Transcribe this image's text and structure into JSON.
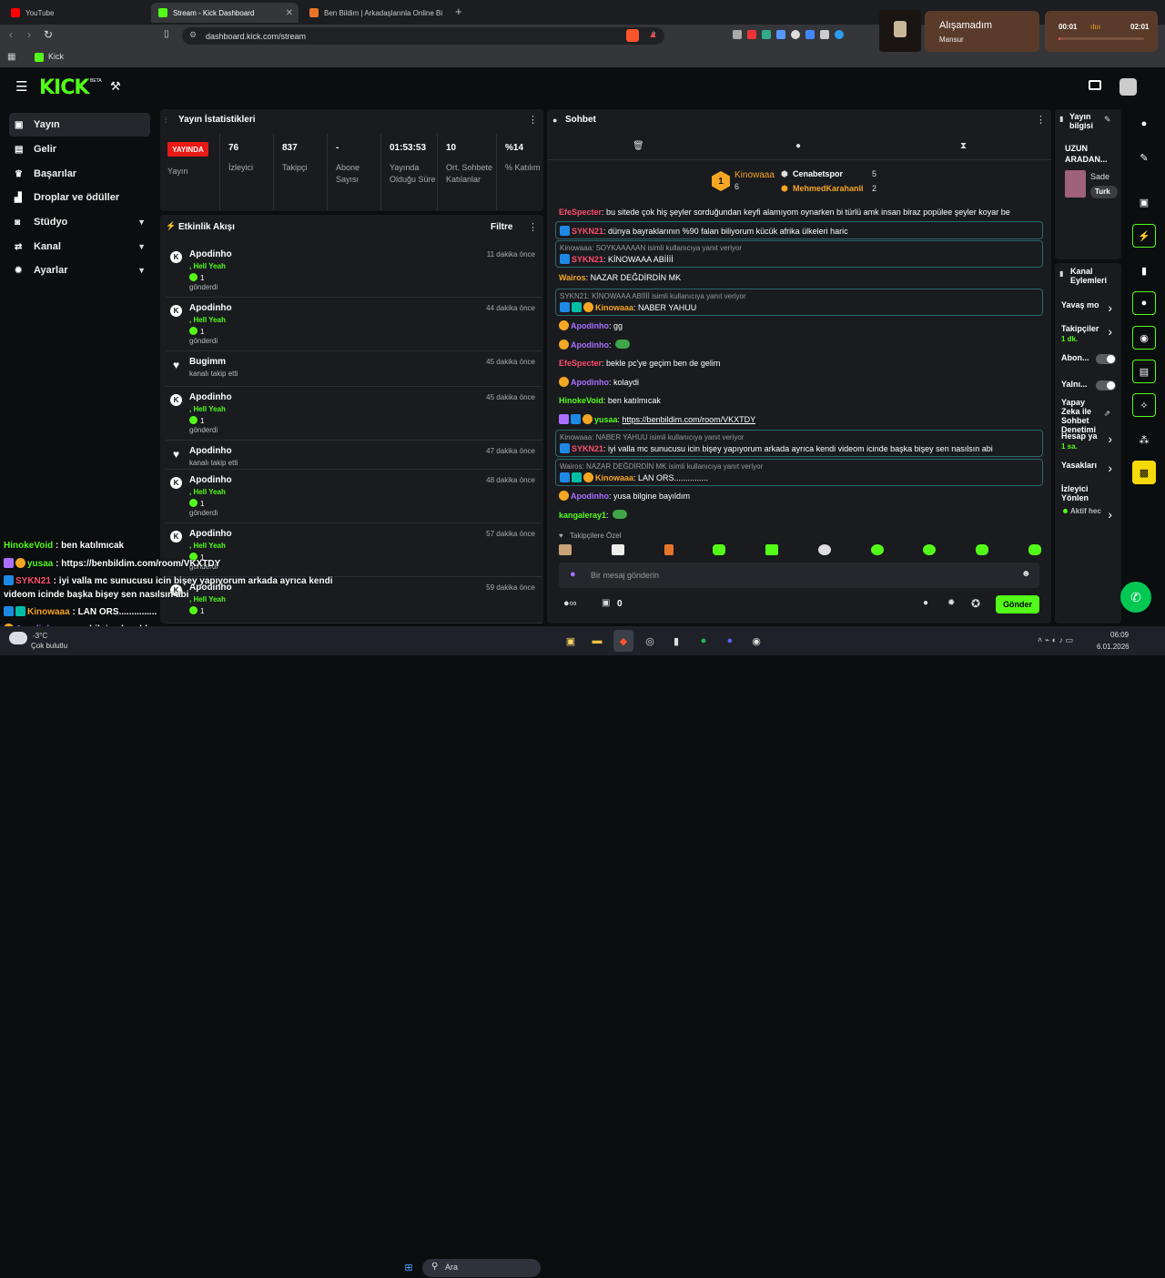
{
  "browser": {
    "tabs": [
      {
        "label": "YouTube",
        "color": "#ff0000"
      },
      {
        "label": "Stream - Kick Dashboard",
        "color": "#53fc18"
      },
      {
        "label": "Ben Bildim | Arkadaşlarınla Online Bil",
        "color": "#e8742a"
      }
    ],
    "new_tab": "+",
    "url": "dashboard.kick.com/stream",
    "bookmark": "Kick"
  },
  "media": {
    "track": "Alışamadım",
    "artist": "Mansur",
    "time_current": "00:01",
    "time_total": "02:01"
  },
  "header": {
    "logo": "KICK",
    "logo_sup": "BETA"
  },
  "sidebar": {
    "items": [
      {
        "label": "Yayın",
        "icon": "broadcast-icon"
      },
      {
        "label": "Gelir",
        "icon": "wallet-icon"
      },
      {
        "label": "Başarılar",
        "icon": "trophy-icon"
      },
      {
        "label": "Droplar ve ödüller",
        "icon": "gift-icon"
      },
      {
        "label": "Stüdyo",
        "icon": "studio-icon"
      },
      {
        "label": "Kanal",
        "icon": "channel-icon"
      },
      {
        "label": "Ayarlar",
        "icon": "gear-icon"
      }
    ]
  },
  "stats": {
    "title": "Yayın İstatistikleri",
    "live_badge": "YAYINDA",
    "live_label": "Yayın",
    "items": [
      {
        "value": "76",
        "label": "İzleyici"
      },
      {
        "value": "837",
        "label": "Takipçi"
      },
      {
        "value": "-",
        "label": "Abone Sayısı"
      },
      {
        "value": "01:53:53",
        "label": "Yayında Olduğu Süre"
      },
      {
        "value": "10",
        "label": "Ort. Sohbete Katılanlar"
      },
      {
        "value": "%14",
        "label": "% Katılım"
      }
    ]
  },
  "activity": {
    "title": "Etkinlik Akışı",
    "filter": "Filtre",
    "events": [
      {
        "who": "Apodinho",
        "line2": ", Hell Yeah",
        "count": "1",
        "line3": "gönderdi",
        "time": "11 dakika önce",
        "type": "kick"
      },
      {
        "who": "Apodinho",
        "line2": ", Hell Yeah",
        "count": "1",
        "line3": "gönderdi",
        "time": "44 dakika önce",
        "type": "kick"
      },
      {
        "who": "Bugimm",
        "line2": "kanalı takip etti",
        "count": "",
        "line3": "",
        "time": "45 dakika önce",
        "type": "heart"
      },
      {
        "who": "Apodinho",
        "line2": ", Hell Yeah",
        "count": "1",
        "line3": "gönderdi",
        "time": "45 dakika önce",
        "type": "kick"
      },
      {
        "who": "Apodinho",
        "line2": "kanalı takip etti",
        "count": "",
        "line3": "",
        "time": "47 dakika önce",
        "type": "heart"
      },
      {
        "who": "Apodinho",
        "line2": ", Hell Yeah",
        "count": "1",
        "line3": "gönderdi",
        "time": "48 dakika önce",
        "type": "kick"
      },
      {
        "who": "Apodinho",
        "line2": ", Hell Yeah",
        "count": "1",
        "line3": "gönderdi",
        "time": "57 dakika önce",
        "type": "kick"
      },
      {
        "who": "Apodinho",
        "line2": ", Hell Yeah",
        "count": "1",
        "line3": "",
        "time": "59 dakika önce",
        "type": "kick"
      }
    ]
  },
  "chat": {
    "title": "Sohbet",
    "leaders": [
      {
        "name": "Kinowaaa",
        "count": "6",
        "color": "#f5a623"
      },
      {
        "name": "Cenabetspor",
        "count": "5",
        "color": "#ffffff"
      },
      {
        "name": "MehmedKarahanli",
        "count": "2",
        "color": "#f5a623"
      }
    ],
    "first_rank": "1",
    "messages": [
      {
        "name": "EfeSpecter",
        "color": "#ff4d6d",
        "text": ": bu sitede çok hiş şeyler sorduğundan keyfi alamıyom oynarken bi türlü amk insan biraz popülee şeyler koyar be"
      },
      {
        "name": "SYKN21",
        "color": "#ff4d6d",
        "text": ": dünya bayraklarının %90 falan biliyorum kücük afrika ülkeleri haric"
      },
      {
        "reply": "Kinowaaa: SOYKAAAAAN isimli kullanıcıya yanıt veriyor",
        "name": "SYKN21",
        "color": "#ff4d6d",
        "text": ": KİNOWAAA ABİİİİ"
      },
      {
        "name": "Wairos",
        "color": "#f5a623",
        "text": ": NAZAR DEĞDİRDİN MK"
      },
      {
        "reply": "SYKN21: KİNOWAAA ABİİİİ isimli kullanıcıya yanıt veriyor",
        "name": "Kinowaaa",
        "color": "#f5a623",
        "text": ": NABER YAHUU"
      },
      {
        "name": "Apodinho",
        "color": "#a970ff",
        "text": ": gg"
      },
      {
        "name": "Apodinho",
        "color": "#a970ff",
        "text": ":"
      },
      {
        "name": "EfeSpecter",
        "color": "#ff4d6d",
        "text": ": bekle pc'ye geçim ben de gelim"
      },
      {
        "name": "Apodinho",
        "color": "#a970ff",
        "text": ": kolaydi"
      },
      {
        "name": "HinokeVoid",
        "color": "#53fc18",
        "text": ": ben katılmıcak"
      },
      {
        "name": "yusaa",
        "color": "#53fc18",
        "text": ": ",
        "link": "https://benbildim.com/room/VKXTDY"
      },
      {
        "reply": "Kinowaaa: NABER YAHUU isimli kullanıcıya yanıt veriyor",
        "name": "SYKN21",
        "color": "#ff4d6d",
        "text": ": iyi valla mc sunucusu icin bişey yapıyorum arkada ayrıca kendi videom icinde başka bişey sen nasılsın abi"
      },
      {
        "reply": "Wairos: NAZAR DEĞDİRDİN MK isimli kullanıcıya yanıt veriyor",
        "name": "Kinowaaa",
        "color": "#f5a623",
        "text": ": LAN ORS..............."
      },
      {
        "name": "Apodinho",
        "color": "#a970ff",
        "text": ": yusa bilgine bayıldım"
      },
      {
        "name": "kangaleray1",
        "color": "#53fc18",
        "text": ":"
      }
    ],
    "emote_label": "Takipçilere Özel",
    "input_placeholder": "Bir mesaj gönderin",
    "points": "0",
    "send": "Gönder"
  },
  "stream_info": {
    "title": "Yayın bilgisi",
    "stream_title": "UZUN ARADAN...",
    "category": "Sade",
    "tag": "Turk"
  },
  "channel_actions": {
    "title": "Kanal Eylemleri",
    "items": [
      {
        "label": "Yavaş mo",
        "sub": "",
        "kind": "chevron"
      },
      {
        "label": "Takipçiler",
        "sub": "1 dk.",
        "kind": "chevron"
      },
      {
        "label": "Abon...",
        "sub": "",
        "kind": "toggle"
      },
      {
        "label": "Yalnı...",
        "sub": "",
        "kind": "toggle"
      },
      {
        "label": "Yapay Zeka ile Sohbet Denetimi",
        "sub": "",
        "kind": "external"
      },
      {
        "label": "Hesap ya",
        "sub": "1 sa.",
        "kind": "chevron"
      },
      {
        "label": "Yasakları",
        "sub": "",
        "kind": "chevron"
      },
      {
        "label": "İzleyici Yönlen",
        "sub": "",
        "kind": "none"
      },
      {
        "label": "Aktif hec",
        "sub": "",
        "kind": "chevron"
      }
    ]
  },
  "overlay_chat": [
    {
      "name": "HinokeVoid",
      "color": "#53fc18",
      "text": " : ben katılmıcak"
    },
    {
      "name": "yusaa",
      "color": "#53fc18",
      "text": " : https://benbildim.com/room/VKXTDY"
    },
    {
      "name": "SYKN21",
      "color": "#ff4d6d",
      "text": " : iyi valla mc sunucusu icin bişey yapıyorum arkada ayrıca kendi"
    },
    {
      "name": "",
      "color": "#ffffff",
      "text": "videom icinde başka bişey sen nasılsın abi"
    },
    {
      "name": "Kinowaaa",
      "color": "#f5a623",
      "text": " : LAN ORS..............."
    },
    {
      "name": "Apodinho",
      "color": "#a970ff",
      "text": " : yusa bilgine bayıldım"
    }
  ],
  "taskbar": {
    "weather_temp": "-3°C",
    "weather_text": "Çok bulutlu",
    "search": "Ara",
    "time": "06:09",
    "date": "6.01.2026"
  }
}
